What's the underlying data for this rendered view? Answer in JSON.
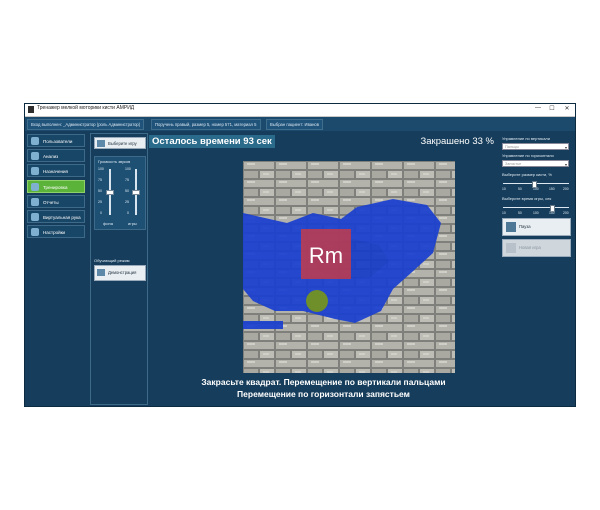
{
  "window": {
    "title": "Тренажер мелкой моторики кисти АМРИД",
    "controls": [
      "—",
      "☐",
      "✕"
    ]
  },
  "infobar": {
    "login": "Вход выполнен: _Администратор   (роль Администратор)",
    "patient": "Выбран пациент: Иванов",
    "params": "Поручень правый, размер 5, номер 571, материал 5"
  },
  "nav": {
    "items": [
      {
        "label": "Пользователи",
        "icon": "users-icon"
      },
      {
        "label": "Анализ",
        "icon": "analysis-icon"
      },
      {
        "label": "Назначения",
        "icon": "assignments-icon"
      },
      {
        "label": "Тренировка",
        "icon": "training-icon",
        "active": true
      },
      {
        "label": "Отчеты",
        "icon": "reports-icon"
      },
      {
        "label": "Виртуальная рука",
        "icon": "hand-icon"
      },
      {
        "label": "Настройки",
        "icon": "settings-icon"
      }
    ]
  },
  "left": {
    "choose_game": "Выберите игру",
    "volume_title": "Громкость звуков",
    "ticks": [
      "100",
      "75",
      "50",
      "25",
      "0"
    ],
    "background_label": "фона",
    "game_label": "игры",
    "background_level": 0.5,
    "game_level": 0.5,
    "training_mode": "Обучающий режим",
    "demo_button": "Демонстрация"
  },
  "center": {
    "timer": "Осталось времени 93 сек",
    "painted": "Закрашено 33 %",
    "logo_text": "Rm",
    "instruction_line1": "Закрасьте квадрат. Перемещение по вертикали пальцами",
    "instruction_line2": "Перемещение по горизонтали запястьем",
    "painted_percent": 33
  },
  "right": {
    "vertical_label": "Управление по вертикали",
    "vertical_value": "Пальцы",
    "horizontal_label": "Управление по горизонтали",
    "horizontal_value": "Запястье",
    "brush_label": "Выберите размер кисти, %",
    "brush_ticks": [
      "10",
      "50",
      "100",
      "150",
      "200"
    ],
    "brush_value": 100,
    "time_label": "Выберите время игры, сек",
    "time_ticks": [
      "10",
      "50",
      "100",
      "150",
      "200"
    ],
    "time_value": 150,
    "pause_button": "Пауза",
    "new_game_button": "Новая игра"
  },
  "colors": {
    "window_bg": "#163d5b",
    "active_nav": "#5cb33a",
    "paint": "#1a3fd0",
    "cursor": "#6f8f2a",
    "logo_bg": "#d83a3a"
  }
}
